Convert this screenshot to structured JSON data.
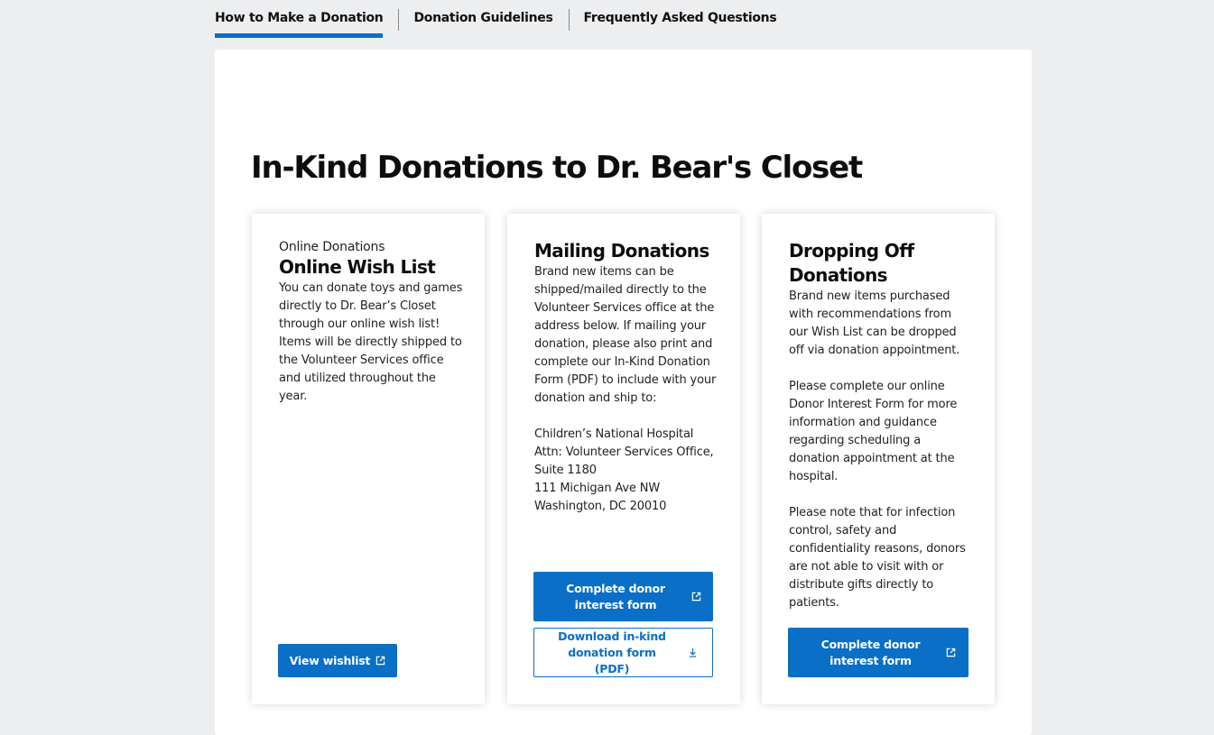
{
  "tabs": [
    {
      "label": "How to Make a Donation",
      "active": true
    },
    {
      "label": "Donation Guidelines",
      "active": false
    },
    {
      "label": "Frequently Asked Questions",
      "active": false
    }
  ],
  "page_title": "In-Kind Donations to Dr. Bear's Closet",
  "cards": [
    {
      "eyebrow": "Online Donations",
      "title": "Online Wish List",
      "body": "You can donate toys and games directly to Dr. Bear’s Closet through our online wish list! Items will be directly shipped to the Volunteer Services office and utilized throughout the year.",
      "buttons": [
        {
          "label": "View wishlist",
          "icon": "external-link-icon"
        }
      ]
    },
    {
      "title": "Mailing Donations",
      "body": "Brand new items can be shipped/mailed directly to the Volunteer Services office at the address below. If mailing your donation, please also print and complete our In-Kind Donation Form (PDF) to include with your donation and ship to:\n\nChildren’s National Hospital\nAttn: Volunteer Services Office, Suite 1180\n111 Michigan Ave NW\nWashington, DC 20010",
      "buttons": [
        {
          "label": "Complete donor interest form",
          "icon": "external-link-icon"
        },
        {
          "label": "Download in-kind donation form (PDF)",
          "icon": "download-icon"
        }
      ]
    },
    {
      "title": "Dropping Off Donations",
      "body": "Brand new items purchased with recommendations from our Wish List can be dropped off via donation appointment.\n\nPlease complete our online Donor Interest Form for more information and guidance regarding scheduling a donation appointment at the hospital.\n\nPlease note that for infection control, safety and confidentiality reasons, donors are not able to visit with or distribute gifts directly to patients.",
      "buttons": [
        {
          "label": "Complete donor interest form",
          "icon": "external-link-icon"
        }
      ]
    }
  ],
  "colors": {
    "accent": "#0a6fc7",
    "background": "#edeef0",
    "panel": "#ffffff"
  }
}
